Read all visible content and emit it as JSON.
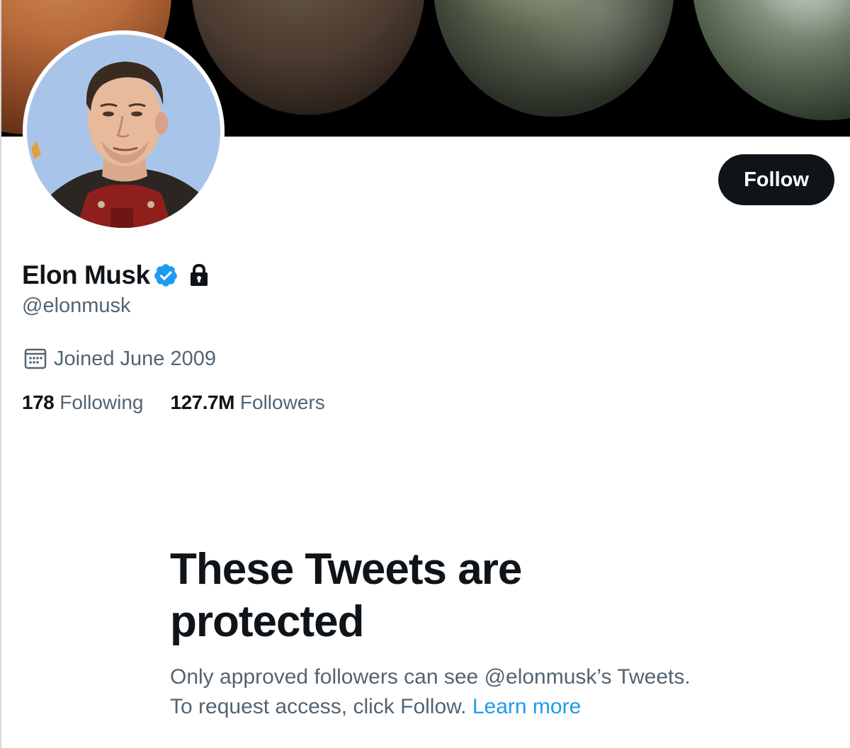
{
  "profile": {
    "display_name": "Elon Musk",
    "handle": "@elonmusk",
    "joined": "Joined June 2009",
    "following_count": "178",
    "following_label": "Following",
    "followers_count": "127.7M",
    "followers_label": "Followers"
  },
  "actions": {
    "follow_label": "Follow"
  },
  "protected": {
    "title": "These Tweets are protected",
    "description": "Only approved followers can see @elonmusk’s Tweets. To request access, click Follow.",
    "learn_more": "Learn more"
  },
  "icons": {
    "verified": "verified-badge-icon",
    "lock": "lock-icon",
    "calendar": "calendar-icon"
  },
  "colors": {
    "text_primary": "#0f1419",
    "text_secondary": "#536471",
    "accent": "#1d9bf0",
    "button_bg": "#0f1419"
  }
}
